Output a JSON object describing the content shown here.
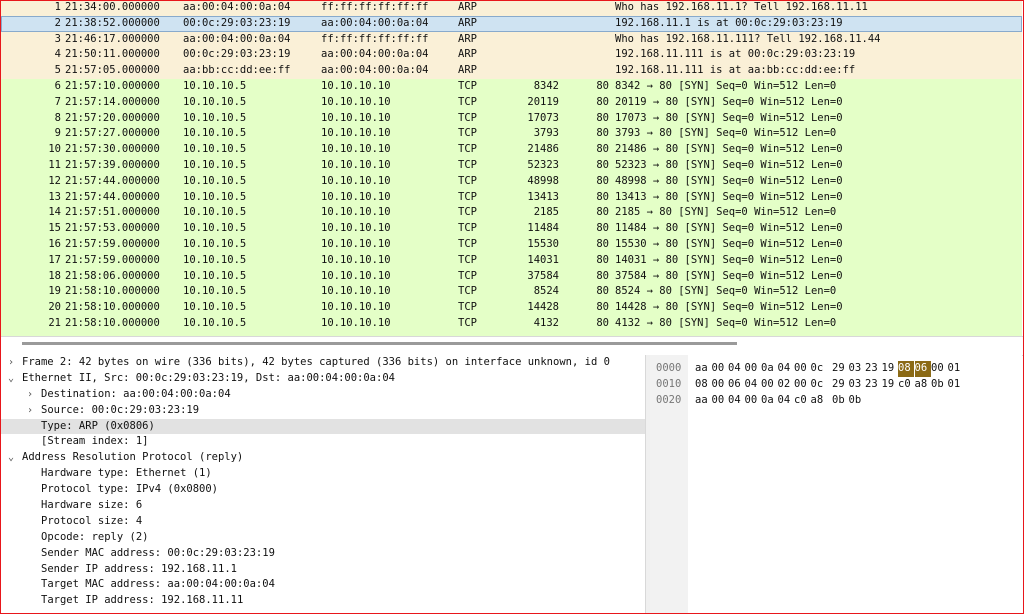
{
  "packets": [
    {
      "no": "1",
      "time": "21:34:00.000000",
      "src": "aa:00:04:00:0a:04",
      "dst": "ff:ff:ff:ff:ff:ff",
      "proto": "ARP",
      "sport": "",
      "dport": "",
      "info": "Who has 192.168.11.1? Tell 192.168.11.11",
      "kind": "arp"
    },
    {
      "no": "2",
      "time": "21:38:52.000000",
      "src": "00:0c:29:03:23:19",
      "dst": "aa:00:04:00:0a:04",
      "proto": "ARP",
      "sport": "",
      "dport": "",
      "info": "192.168.11.1 is at 00:0c:29:03:23:19",
      "kind": "arp",
      "selected": true
    },
    {
      "no": "3",
      "time": "21:46:17.000000",
      "src": "aa:00:04:00:0a:04",
      "dst": "ff:ff:ff:ff:ff:ff",
      "proto": "ARP",
      "sport": "",
      "dport": "",
      "info": "Who has 192.168.11.111? Tell 192.168.11.44",
      "kind": "arp"
    },
    {
      "no": "4",
      "time": "21:50:11.000000",
      "src": "00:0c:29:03:23:19",
      "dst": "aa:00:04:00:0a:04",
      "proto": "ARP",
      "sport": "",
      "dport": "",
      "info": "192.168.11.111 is at 00:0c:29:03:23:19",
      "kind": "arp"
    },
    {
      "no": "5",
      "time": "21:57:05.000000",
      "src": "aa:bb:cc:dd:ee:ff",
      "dst": "aa:00:04:00:0a:04",
      "proto": "ARP",
      "sport": "",
      "dport": "",
      "info": "192.168.11.111 is at aa:bb:cc:dd:ee:ff",
      "kind": "arp"
    },
    {
      "no": "6",
      "time": "21:57:10.000000",
      "src": "10.10.10.5",
      "dst": "10.10.10.10",
      "proto": "TCP",
      "sport": "8342",
      "dport": "80",
      "info": "8342 → 80 [SYN] Seq=0 Win=512 Len=0",
      "kind": "tcp"
    },
    {
      "no": "7",
      "time": "21:57:14.000000",
      "src": "10.10.10.5",
      "dst": "10.10.10.10",
      "proto": "TCP",
      "sport": "20119",
      "dport": "80",
      "info": "20119 → 80 [SYN] Seq=0 Win=512 Len=0",
      "kind": "tcp"
    },
    {
      "no": "8",
      "time": "21:57:20.000000",
      "src": "10.10.10.5",
      "dst": "10.10.10.10",
      "proto": "TCP",
      "sport": "17073",
      "dport": "80",
      "info": "17073 → 80 [SYN] Seq=0 Win=512 Len=0",
      "kind": "tcp"
    },
    {
      "no": "9",
      "time": "21:57:27.000000",
      "src": "10.10.10.5",
      "dst": "10.10.10.10",
      "proto": "TCP",
      "sport": "3793",
      "dport": "80",
      "info": "3793 → 80 [SYN] Seq=0 Win=512 Len=0",
      "kind": "tcp"
    },
    {
      "no": "10",
      "time": "21:57:30.000000",
      "src": "10.10.10.5",
      "dst": "10.10.10.10",
      "proto": "TCP",
      "sport": "21486",
      "dport": "80",
      "info": "21486 → 80 [SYN] Seq=0 Win=512 Len=0",
      "kind": "tcp"
    },
    {
      "no": "11",
      "time": "21:57:39.000000",
      "src": "10.10.10.5",
      "dst": "10.10.10.10",
      "proto": "TCP",
      "sport": "52323",
      "dport": "80",
      "info": "52323 → 80 [SYN] Seq=0 Win=512 Len=0",
      "kind": "tcp"
    },
    {
      "no": "12",
      "time": "21:57:44.000000",
      "src": "10.10.10.5",
      "dst": "10.10.10.10",
      "proto": "TCP",
      "sport": "48998",
      "dport": "80",
      "info": "48998 → 80 [SYN] Seq=0 Win=512 Len=0",
      "kind": "tcp"
    },
    {
      "no": "13",
      "time": "21:57:44.000000",
      "src": "10.10.10.5",
      "dst": "10.10.10.10",
      "proto": "TCP",
      "sport": "13413",
      "dport": "80",
      "info": "13413 → 80 [SYN] Seq=0 Win=512 Len=0",
      "kind": "tcp"
    },
    {
      "no": "14",
      "time": "21:57:51.000000",
      "src": "10.10.10.5",
      "dst": "10.10.10.10",
      "proto": "TCP",
      "sport": "2185",
      "dport": "80",
      "info": "2185 → 80 [SYN] Seq=0 Win=512 Len=0",
      "kind": "tcp"
    },
    {
      "no": "15",
      "time": "21:57:53.000000",
      "src": "10.10.10.5",
      "dst": "10.10.10.10",
      "proto": "TCP",
      "sport": "11484",
      "dport": "80",
      "info": "11484 → 80 [SYN] Seq=0 Win=512 Len=0",
      "kind": "tcp"
    },
    {
      "no": "16",
      "time": "21:57:59.000000",
      "src": "10.10.10.5",
      "dst": "10.10.10.10",
      "proto": "TCP",
      "sport": "15530",
      "dport": "80",
      "info": "15530 → 80 [SYN] Seq=0 Win=512 Len=0",
      "kind": "tcp"
    },
    {
      "no": "17",
      "time": "21:57:59.000000",
      "src": "10.10.10.5",
      "dst": "10.10.10.10",
      "proto": "TCP",
      "sport": "14031",
      "dport": "80",
      "info": "14031 → 80 [SYN] Seq=0 Win=512 Len=0",
      "kind": "tcp"
    },
    {
      "no": "18",
      "time": "21:58:06.000000",
      "src": "10.10.10.5",
      "dst": "10.10.10.10",
      "proto": "TCP",
      "sport": "37584",
      "dport": "80",
      "info": "37584 → 80 [SYN] Seq=0 Win=512 Len=0",
      "kind": "tcp"
    },
    {
      "no": "19",
      "time": "21:58:10.000000",
      "src": "10.10.10.5",
      "dst": "10.10.10.10",
      "proto": "TCP",
      "sport": "8524",
      "dport": "80",
      "info": "8524 → 80 [SYN] Seq=0 Win=512 Len=0",
      "kind": "tcp"
    },
    {
      "no": "20",
      "time": "21:58:10.000000",
      "src": "10.10.10.5",
      "dst": "10.10.10.10",
      "proto": "TCP",
      "sport": "14428",
      "dport": "80",
      "info": "14428 → 80 [SYN] Seq=0 Win=512 Len=0",
      "kind": "tcp"
    },
    {
      "no": "21",
      "time": "21:58:10.000000",
      "src": "10.10.10.5",
      "dst": "10.10.10.10",
      "proto": "TCP",
      "sport": "4132",
      "dport": "80",
      "info": "4132 → 80 [SYN] Seq=0 Win=512 Len=0",
      "kind": "tcp"
    }
  ],
  "details": [
    {
      "level": 0,
      "arrow": "›",
      "text": "Frame 2: 42 bytes on wire (336 bits), 42 bytes captured (336 bits) on interface unknown, id 0",
      "expandable": true
    },
    {
      "level": 0,
      "arrow": "⌄",
      "text": "Ethernet II, Src: 00:0c:29:03:23:19, Dst: aa:00:04:00:0a:04",
      "expandable": true
    },
    {
      "level": 1,
      "arrow": "›",
      "text": "Destination: aa:00:04:00:0a:04",
      "expandable": true
    },
    {
      "level": 1,
      "arrow": "›",
      "text": "Source: 00:0c:29:03:23:19",
      "expandable": true
    },
    {
      "level": 1,
      "arrow": "",
      "text": "Type: ARP (0x0806)",
      "highlighted": true
    },
    {
      "level": 1,
      "arrow": "",
      "text": "[Stream index: 1]"
    },
    {
      "level": 0,
      "arrow": "⌄",
      "text": "Address Resolution Protocol (reply)",
      "expandable": true
    },
    {
      "level": 1,
      "arrow": "",
      "text": "Hardware type: Ethernet (1)"
    },
    {
      "level": 1,
      "arrow": "",
      "text": "Protocol type: IPv4 (0x0800)"
    },
    {
      "level": 1,
      "arrow": "",
      "text": "Hardware size: 6"
    },
    {
      "level": 1,
      "arrow": "",
      "text": "Protocol size: 4"
    },
    {
      "level": 1,
      "arrow": "",
      "text": "Opcode: reply (2)"
    },
    {
      "level": 1,
      "arrow": "",
      "text": "Sender MAC address: 00:0c:29:03:23:19"
    },
    {
      "level": 1,
      "arrow": "",
      "text": "Sender IP address: 192.168.11.1"
    },
    {
      "level": 1,
      "arrow": "",
      "text": "Target MAC address: aa:00:04:00:0a:04"
    },
    {
      "level": 1,
      "arrow": "",
      "text": "Target IP address: 192.168.11.11"
    }
  ],
  "bytes": [
    {
      "offset": "0000",
      "hex": [
        "aa",
        "00",
        "04",
        "00",
        "0a",
        "04",
        "00",
        "0c",
        "29",
        "03",
        "23",
        "19",
        "08",
        "06",
        "00",
        "01"
      ],
      "selected": [
        12,
        13
      ]
    },
    {
      "offset": "0010",
      "hex": [
        "08",
        "00",
        "06",
        "04",
        "00",
        "02",
        "00",
        "0c",
        "29",
        "03",
        "23",
        "19",
        "c0",
        "a8",
        "0b",
        "01"
      ],
      "selected": []
    },
    {
      "offset": "0020",
      "hex": [
        "aa",
        "00",
        "04",
        "00",
        "0a",
        "04",
        "c0",
        "a8",
        "0b",
        "0b"
      ],
      "selected": []
    }
  ],
  "colors": {
    "arp_row": "#faf0d7",
    "tcp_row": "#e4ffc7",
    "selected_row": "#cfe3f2",
    "selected_byte": "#8b6a16",
    "frame_border": "#e8161b"
  }
}
